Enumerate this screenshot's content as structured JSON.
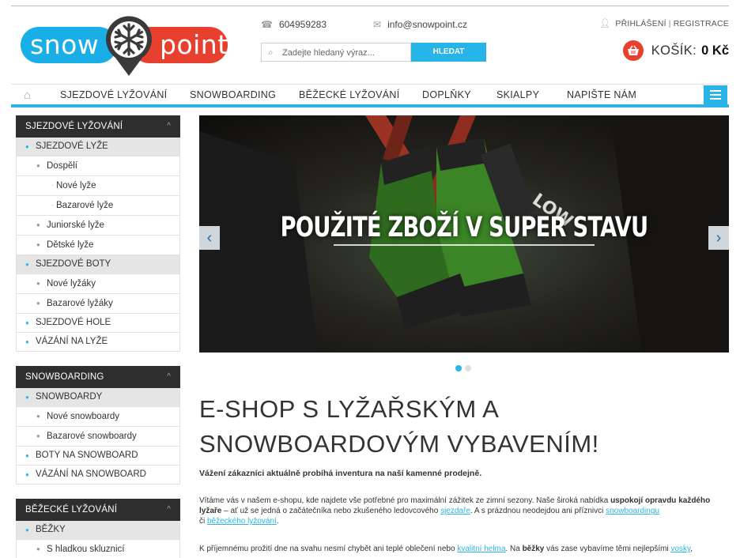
{
  "logo": {
    "left": "snow",
    "right": "point"
  },
  "header": {
    "phone": "604959283",
    "email": "info@snowpoint.cz",
    "search_placeholder": "Zadejte hledaný výraz...",
    "search_button": "HLEDAT",
    "login": "PŘIHLÁŠENÍ",
    "separator": "|",
    "register": "REGISTRACE",
    "cart_label": "KOŠÍK:",
    "cart_value": "0 Kč"
  },
  "nav": {
    "items": [
      "SJEZDOVÉ LYŽOVÁNÍ",
      "SNOWBOARDING",
      "BĚŽECKÉ LYŽOVÁNÍ",
      "DOPLŇKY",
      "SKIALPY",
      "NAPIŠTE NÁM"
    ]
  },
  "sidebar": {
    "sections": [
      {
        "title": "SJEZDOVÉ LYŽOVÁNÍ",
        "items": [
          "SJEZDOVÉ LYŽE",
          "Dospělí",
          "Nové lyže",
          "Bazarové lyže",
          "Juniorské lyže",
          "Dětské lyže",
          "SJEZDOVÉ BOTY",
          "Nové lyžáky",
          "Bazarové lyžáky",
          "SJEZDOVÉ HOLE",
          "VÁZÁNÍ NA LYŽE"
        ]
      },
      {
        "title": "SNOWBOARDING",
        "items": [
          "SNOWBOARDY",
          "Nové snowboardy",
          "Bazarové snowboardy",
          "BOTY NA SNOWBOARD",
          "VÁZÁNÍ NA SNOWBOARD"
        ]
      },
      {
        "title": "BĚŽECKÉ LYŽOVÁNÍ",
        "items": [
          "BĚŽKY",
          "S hladkou skluznicí"
        ]
      }
    ]
  },
  "slider": {
    "caption": "POUŽITÉ ZBOŽÍ V SUPER STAVU",
    "prev": "‹",
    "next": "›"
  },
  "main": {
    "title": "E-SHOP S LYŽAŘSKÝM A SNOWBOARDOVÝM VYBAVENÍM!",
    "intro": "Vážení zákazníci aktuálně probíhá inventura na naší kamenné prodejně.",
    "p1_a": "Vítáme vás v našem e-shopu, kde najdete vše potřebné pro maximální zážitek ze zimní sezony. Naše široká nabídka ",
    "p1_b": "uspokojí opravdu každého lyžaře",
    "p1_c": " – ať už se jedná o začátečníka nebo zkušeného ledovcového ",
    "p1_link1": "sjezdaře",
    "p1_d": ". A s prázdnou neodejdou ani příznivci ",
    "p1_link2": "snowboardingu",
    "p1_e": " či ",
    "p1_link3": "běžeckého lyžování",
    "p1_f": ".",
    "p2_a": "K příjemnému prožití dne na svahu nesmí chybět ani teplé oblečení nebo ",
    "p2_link1": "kvalitní helma",
    "p2_b": ". Na ",
    "p2_bold": "běžky",
    "p2_c": " vás zase vybavíme těmi nejlepšími ",
    "p2_link2": "vosky",
    "p2_d": ","
  },
  "colors": {
    "accent": "#2bb5e6",
    "brand_red": "#e8402e",
    "sidebar_head": "#2e2e2e"
  }
}
